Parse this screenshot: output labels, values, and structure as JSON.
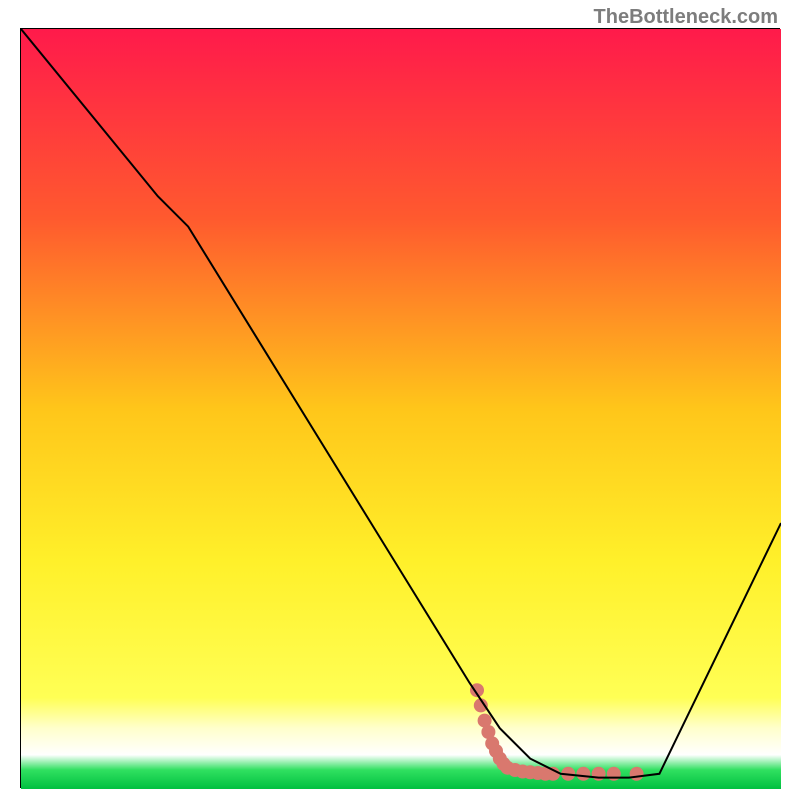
{
  "attribution": "TheBottleneck.com",
  "chart_data": {
    "type": "line",
    "title": "",
    "xlabel": "",
    "ylabel": "",
    "xlim": [
      0,
      100
    ],
    "ylim": [
      0,
      100
    ],
    "grid": false,
    "background_gradient": {
      "stops": [
        {
          "offset": 0.0,
          "color": "#ff1a4b"
        },
        {
          "offset": 0.25,
          "color": "#ff5a2e"
        },
        {
          "offset": 0.5,
          "color": "#ffc61a"
        },
        {
          "offset": 0.7,
          "color": "#fff02a"
        },
        {
          "offset": 0.88,
          "color": "#ffff55"
        },
        {
          "offset": 0.92,
          "color": "#ffffcc"
        },
        {
          "offset": 0.955,
          "color": "#ffffff"
        },
        {
          "offset": 0.975,
          "color": "#30e060"
        },
        {
          "offset": 1.0,
          "color": "#00c040"
        }
      ]
    },
    "series": [
      {
        "name": "curve",
        "color": "#000000",
        "x": [
          0,
          18,
          22,
          59,
          63,
          67,
          71,
          76,
          80,
          84,
          100
        ],
        "y": [
          100,
          78,
          74,
          14,
          8,
          4,
          2,
          1.5,
          1.5,
          2,
          35
        ]
      }
    ],
    "scatter": {
      "name": "markers",
      "color": "#d9786e",
      "points": [
        {
          "x": 60,
          "y": 13
        },
        {
          "x": 60.5,
          "y": 11
        },
        {
          "x": 61,
          "y": 9
        },
        {
          "x": 61.5,
          "y": 7.5
        },
        {
          "x": 62,
          "y": 6
        },
        {
          "x": 62.5,
          "y": 5
        },
        {
          "x": 63,
          "y": 4
        },
        {
          "x": 63.5,
          "y": 3.3
        },
        {
          "x": 64,
          "y": 2.8
        },
        {
          "x": 65,
          "y": 2.5
        },
        {
          "x": 66,
          "y": 2.3
        },
        {
          "x": 67,
          "y": 2.2
        },
        {
          "x": 68,
          "y": 2.1
        },
        {
          "x": 69,
          "y": 2.0
        },
        {
          "x": 70,
          "y": 2.0
        },
        {
          "x": 72,
          "y": 2.0
        },
        {
          "x": 74,
          "y": 2.0
        },
        {
          "x": 76,
          "y": 2.0
        },
        {
          "x": 78,
          "y": 2.0
        },
        {
          "x": 81,
          "y": 2.0
        }
      ]
    }
  }
}
